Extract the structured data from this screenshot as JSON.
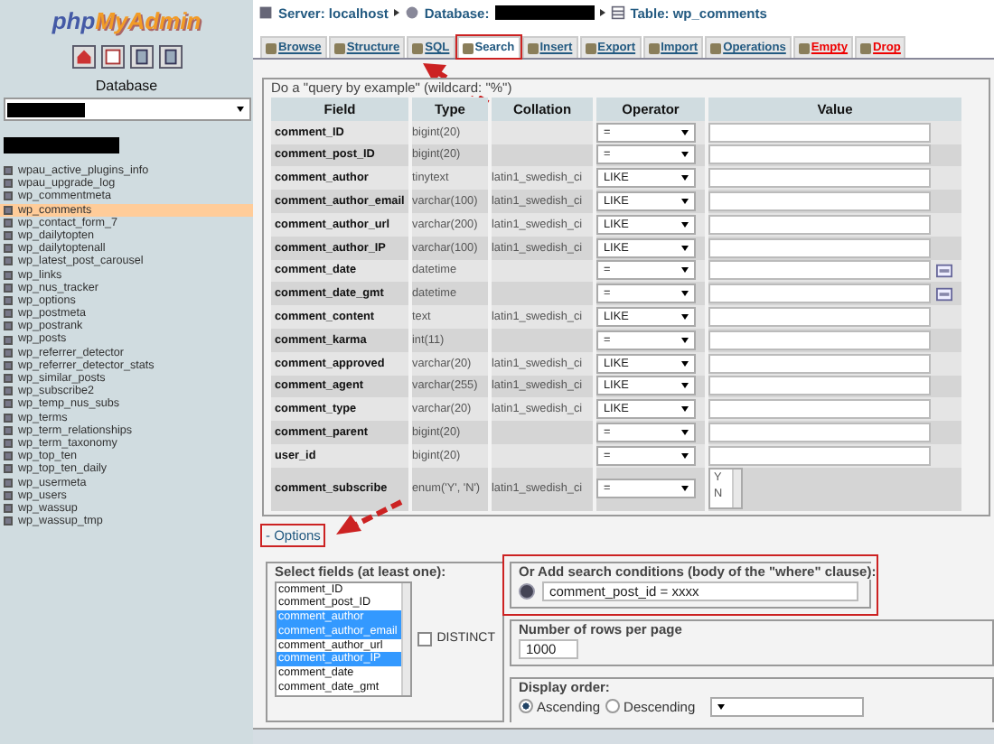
{
  "sidebar": {
    "logo": {
      "part_1": "php",
      "part_2": "MyAdmin"
    },
    "database_label": "Database",
    "tables": [
      {
        "name": "wpau_active_plugins_info",
        "selected": false
      },
      {
        "name": "wpau_upgrade_log",
        "selected": false
      },
      {
        "name": "wp_commentmeta",
        "selected": false
      },
      {
        "name": "wp_comments",
        "selected": true
      },
      {
        "name": "wp_contact_form_7",
        "selected": false
      },
      {
        "name": "wp_dailytopten",
        "selected": false
      },
      {
        "name": "wp_dailytoptenall",
        "selected": false
      },
      {
        "name": "wp_latest_post_carousel",
        "selected": false
      },
      {
        "name": "wp_links",
        "selected": false
      },
      {
        "name": "wp_nus_tracker",
        "selected": false
      },
      {
        "name": "wp_options",
        "selected": false
      },
      {
        "name": "wp_postmeta",
        "selected": false
      },
      {
        "name": "wp_postrank",
        "selected": false
      },
      {
        "name": "wp_posts",
        "selected": false
      },
      {
        "name": "wp_referrer_detector",
        "selected": false
      },
      {
        "name": "wp_referrer_detector_stats",
        "selected": false
      },
      {
        "name": "wp_similar_posts",
        "selected": false
      },
      {
        "name": "wp_subscribe2",
        "selected": false
      },
      {
        "name": "wp_temp_nus_subs",
        "selected": false
      },
      {
        "name": "wp_terms",
        "selected": false
      },
      {
        "name": "wp_term_relationships",
        "selected": false
      },
      {
        "name": "wp_term_taxonomy",
        "selected": false
      },
      {
        "name": "wp_top_ten",
        "selected": false
      },
      {
        "name": "wp_top_ten_daily",
        "selected": false
      },
      {
        "name": "wp_usermeta",
        "selected": false
      },
      {
        "name": "wp_users",
        "selected": false
      },
      {
        "name": "wp_wassup",
        "selected": false
      },
      {
        "name": "wp_wassup_tmp",
        "selected": false
      }
    ]
  },
  "breadcrumb": {
    "server": "Server: localhost",
    "database": "Database:",
    "table": "Table: wp_comments"
  },
  "tabs": [
    {
      "label": "Browse",
      "selected": false,
      "highlighted": false,
      "kind": "normal"
    },
    {
      "label": "Structure",
      "selected": false,
      "highlighted": false,
      "kind": "normal"
    },
    {
      "label": "SQL",
      "selected": false,
      "highlighted": false,
      "kind": "normal"
    },
    {
      "label": "Search",
      "selected": true,
      "highlighted": true,
      "kind": "normal"
    },
    {
      "label": "Insert",
      "selected": false,
      "highlighted": false,
      "kind": "normal"
    },
    {
      "label": "Export",
      "selected": false,
      "highlighted": false,
      "kind": "normal"
    },
    {
      "label": "Import",
      "selected": false,
      "highlighted": false,
      "kind": "normal"
    },
    {
      "label": "Operations",
      "selected": false,
      "highlighted": false,
      "kind": "normal"
    },
    {
      "label": "Empty",
      "selected": false,
      "highlighted": false,
      "kind": "destructive"
    },
    {
      "label": "Drop",
      "selected": false,
      "highlighted": false,
      "kind": "destructive"
    }
  ],
  "query": {
    "legend": "Do a \"query by example\" (wildcard: \"%\")",
    "columns": [
      "Field",
      "Type",
      "Collation",
      "Operator",
      "Value"
    ],
    "rows": [
      {
        "field": "comment_ID",
        "type": "bigint(20)",
        "collation": "",
        "operator": "=",
        "kind": "text"
      },
      {
        "field": "comment_post_ID",
        "type": "bigint(20)",
        "collation": "",
        "operator": "=",
        "kind": "text"
      },
      {
        "field": "comment_author",
        "type": "tinytext",
        "collation": "latin1_swedish_ci",
        "operator": "LIKE",
        "kind": "text"
      },
      {
        "field": "comment_author_email",
        "type": "varchar(100)",
        "collation": "latin1_swedish_ci",
        "operator": "LIKE",
        "kind": "text"
      },
      {
        "field": "comment_author_url",
        "type": "varchar(200)",
        "collation": "latin1_swedish_ci",
        "operator": "LIKE",
        "kind": "text"
      },
      {
        "field": "comment_author_IP",
        "type": "varchar(100)",
        "collation": "latin1_swedish_ci",
        "operator": "LIKE",
        "kind": "text"
      },
      {
        "field": "comment_date",
        "type": "datetime",
        "collation": "",
        "operator": "=",
        "kind": "date"
      },
      {
        "field": "comment_date_gmt",
        "type": "datetime",
        "collation": "",
        "operator": "=",
        "kind": "date"
      },
      {
        "field": "comment_content",
        "type": "text",
        "collation": "latin1_swedish_ci",
        "operator": "LIKE",
        "kind": "text"
      },
      {
        "field": "comment_karma",
        "type": "int(11)",
        "collation": "",
        "operator": "=",
        "kind": "text"
      },
      {
        "field": "comment_approved",
        "type": "varchar(20)",
        "collation": "latin1_swedish_ci",
        "operator": "LIKE",
        "kind": "text"
      },
      {
        "field": "comment_agent",
        "type": "varchar(255)",
        "collation": "latin1_swedish_ci",
        "operator": "LIKE",
        "kind": "text"
      },
      {
        "field": "comment_type",
        "type": "varchar(20)",
        "collation": "latin1_swedish_ci",
        "operator": "LIKE",
        "kind": "text"
      },
      {
        "field": "comment_parent",
        "type": "bigint(20)",
        "collation": "",
        "operator": "=",
        "kind": "text"
      },
      {
        "field": "user_id",
        "type": "bigint(20)",
        "collation": "",
        "operator": "=",
        "kind": "text"
      },
      {
        "field": "comment_subscribe",
        "type": "enum('Y', 'N')",
        "collation": "latin1_swedish_ci",
        "operator": "=",
        "kind": "enum",
        "options": [
          "Y",
          "N"
        ]
      }
    ]
  },
  "options_link": {
    "label": "- Options",
    "highlighted": true
  },
  "select_fields": {
    "legend": "Select fields (at least one):",
    "items": [
      {
        "name": "comment_ID",
        "selected": false
      },
      {
        "name": "comment_post_ID",
        "selected": false
      },
      {
        "name": "comment_author",
        "selected": true
      },
      {
        "name": "comment_author_email",
        "selected": true
      },
      {
        "name": "comment_author_url",
        "selected": false
      },
      {
        "name": "comment_author_IP",
        "selected": true
      },
      {
        "name": "comment_date",
        "selected": false
      },
      {
        "name": "comment_date_gmt",
        "selected": false
      }
    ]
  },
  "distinct": {
    "label": "DISTINCT",
    "checked": false
  },
  "where": {
    "legend": "Or Add search conditions (body of the \"where\" clause):",
    "value": "comment_post_id = xxxx",
    "highlighted": true
  },
  "rows_per_page": {
    "legend": "Number of rows per page",
    "value": "1000"
  },
  "display_order": {
    "legend": "Display order:",
    "options": [
      {
        "label": "Ascending",
        "selected": true
      },
      {
        "label": "Descending",
        "selected": false
      }
    ]
  }
}
